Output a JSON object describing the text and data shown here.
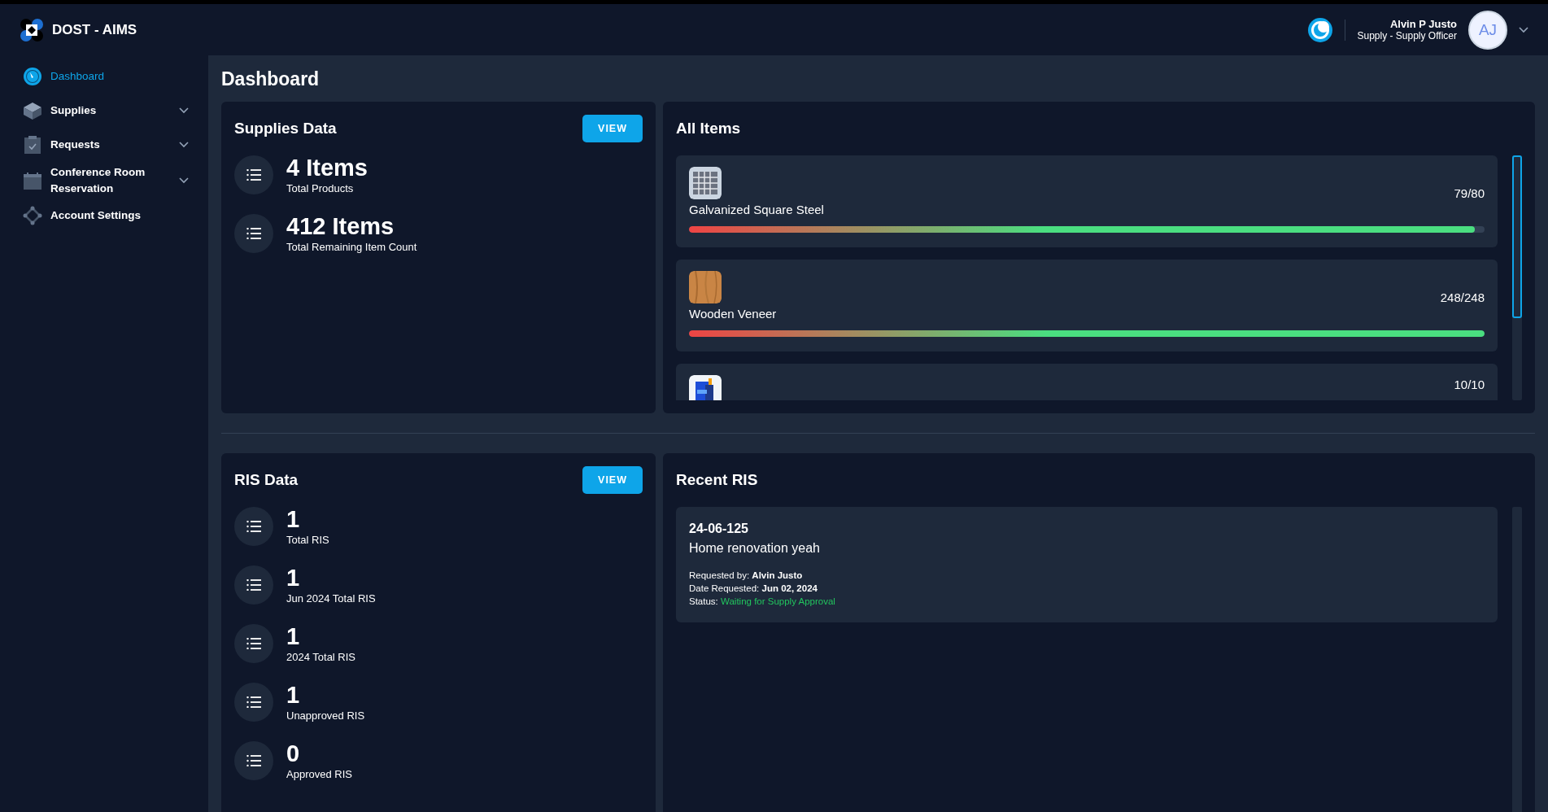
{
  "brand": {
    "name": "DOST - AIMS"
  },
  "sidebar": {
    "items": [
      {
        "label": "Dashboard",
        "kind": "link",
        "selected": true
      },
      {
        "label": "Supplies",
        "kind": "group",
        "selected": false
      },
      {
        "label": "Requests",
        "kind": "group",
        "selected": false
      },
      {
        "label": "Conference Room Reservation",
        "kind": "group",
        "selected": false
      },
      {
        "label": "Account Settings",
        "kind": "link",
        "selected": false
      }
    ]
  },
  "header": {
    "user_name": "Alvin P Justo",
    "user_role": "Supply - Supply Officer",
    "avatar_initials": "AJ"
  },
  "page_title": "Dashboard",
  "supplies_card": {
    "title": "Supplies Data",
    "button": "VIEW",
    "stats": [
      {
        "value": "4 Items",
        "label": "Total Products"
      },
      {
        "value": "412 Items",
        "label": "Total Remaining Item Count"
      }
    ]
  },
  "all_items": {
    "title": "All Items",
    "items": [
      {
        "name": "Galvanized Square Steel",
        "count": "79/80",
        "level": 0.9875
      },
      {
        "name": "Wooden Veneer",
        "count": "248/248",
        "level": 1
      },
      {
        "count": "10/10"
      }
    ]
  },
  "ris_card": {
    "title": "RIS Data",
    "button": "VIEW",
    "stats": [
      {
        "value": "1",
        "label": "Total RIS"
      },
      {
        "value": "1",
        "label": "Jun 2024 Total RIS"
      },
      {
        "value": "1",
        "label": "2024 Total RIS"
      },
      {
        "value": "1",
        "label": "Unapproved RIS"
      },
      {
        "value": "0",
        "label": "Approved RIS"
      }
    ]
  },
  "recent_ris": {
    "title": "Recent RIS",
    "entries": [
      {
        "code": "24-06-125",
        "title": "Home renovation yeah",
        "details": [
          "Requested by: **Alvin Justo**",
          "Date Requested: **Jun 02, 2024**"
        ],
        "status_label": "Status:",
        "status": "Waiting for Supply Approval"
      }
    ]
  }
}
